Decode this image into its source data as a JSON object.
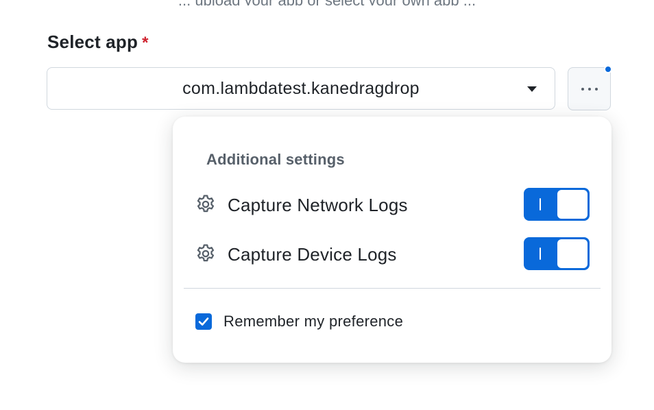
{
  "header": {
    "cutoff_text": "... upload your app or select your own app ..."
  },
  "form": {
    "select_label": "Select app",
    "required_mark": "*",
    "selected_app": "com.lambdatest.kanedragdrop",
    "dropdown_icon": "chevron-down-icon",
    "more_icon": "more-horizontal-icon"
  },
  "popover": {
    "title": "Additional settings",
    "settings": [
      {
        "label": "Capture Network Logs",
        "icon": "gear-icon",
        "enabled": true
      },
      {
        "label": "Capture Device Logs",
        "icon": "gear-icon",
        "enabled": true
      }
    ],
    "remember": {
      "label": "Remember my preference",
      "checked": true
    }
  },
  "colors": {
    "accent": "#0969da",
    "required": "#cf222e",
    "text": "#1f2328",
    "muted": "#57606a",
    "border": "#d0d7de"
  }
}
